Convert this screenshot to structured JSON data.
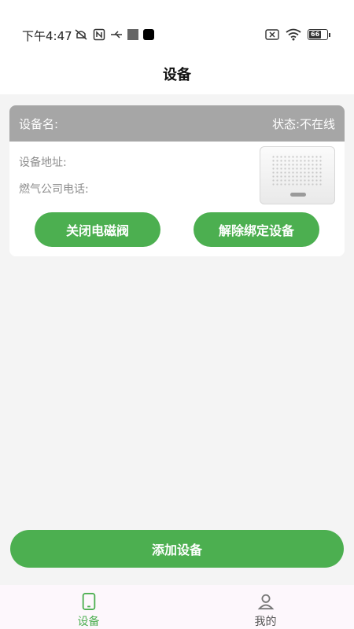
{
  "status_bar": {
    "time": "下午4:47",
    "left_icons": [
      "mute-icon",
      "nfc-icon",
      "usb-icon",
      "gray-square-icon",
      "black-square-icon"
    ],
    "right_icons": [
      "no-sim-icon",
      "wifi-icon",
      "battery-icon"
    ],
    "battery_level": "66"
  },
  "header": {
    "title": "设备"
  },
  "device_card": {
    "name_label": "设备名:",
    "status_label": "状态:不在线",
    "address_label": "设备地址:",
    "gas_phone_label": "燃气公司电话:",
    "close_valve_button": "关闭电磁阀",
    "unbind_button": "解除绑定设备"
  },
  "add_device_button": "添加设备",
  "tab_bar": {
    "tabs": [
      {
        "label": "设备",
        "icon": "phone-icon",
        "active": true
      },
      {
        "label": "我的",
        "icon": "person-icon",
        "active": false
      }
    ]
  },
  "colors": {
    "accent": "#4caf50",
    "card_header": "#a6a6a6",
    "background": "#f4f4f4"
  }
}
